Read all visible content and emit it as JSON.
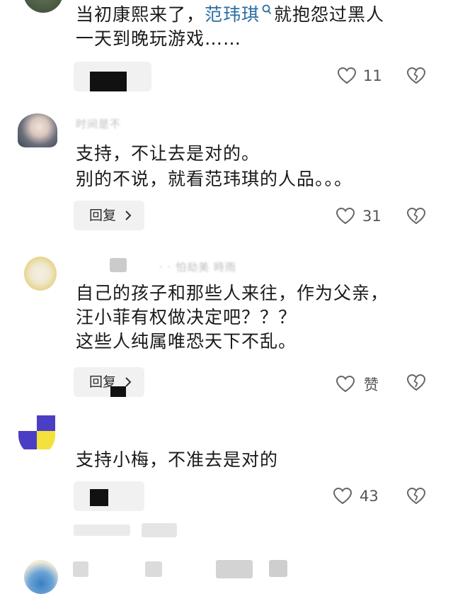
{
  "comments": [
    {
      "lines": [
        "当初康熙来了，",
        "范玮琪",
        "就抱怨过黑人",
        "一天到晚玩游戏……"
      ],
      "reply_label": "",
      "like_count": "11"
    },
    {
      "lines": [
        "支持，不让去是对的。",
        "别的不说，就看范玮琪的人品。。。"
      ],
      "reply_label": "回复",
      "like_count": "31"
    },
    {
      "lines": [
        "自己的孩子和那些人来往，作为父亲，",
        "汪小菲有权做决定吧？？？",
        "这些人纯属唯恐天下不乱。"
      ],
      "reply_label": "回复",
      "like_count": "赞"
    },
    {
      "lines": [
        "支持小梅，不准去是对的"
      ],
      "reply_label": "",
      "like_count": "43"
    }
  ],
  "icons": {
    "heart": "heart-icon",
    "dislike": "broken-heart-icon",
    "search": "search-icon",
    "chevron": "chevron-right-icon"
  },
  "colors": {
    "mention": "#2a6fa3",
    "text": "#1a1a1a",
    "pill": "#f1f1f1"
  }
}
